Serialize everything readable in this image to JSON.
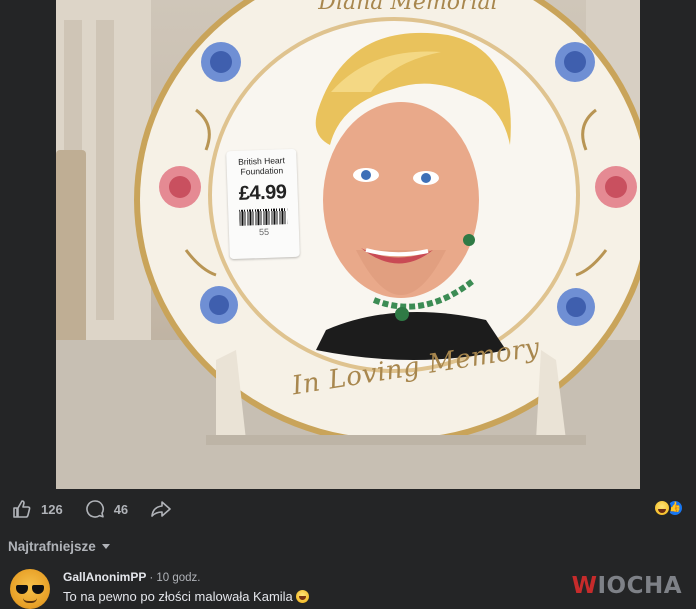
{
  "post": {
    "price_tag": {
      "shop": "British Heart Foundation",
      "price": "£4.99",
      "code": "55"
    },
    "plate_caption": "In Loving Memory",
    "plate_top_text": "Diana Memorial"
  },
  "actions": {
    "likes": "126",
    "comments": "46",
    "reactions": [
      "haha",
      "like"
    ]
  },
  "sort": {
    "label": "Najtrafniejsze"
  },
  "comment": {
    "author": "GallAnonimPP",
    "separator": "·",
    "time": "10 godz.",
    "text": "To na pewno po złości malowała Kamila"
  },
  "watermark": {
    "first": "W",
    "rest": "IOCHA"
  },
  "colors": {
    "background": "#242526",
    "text_secondary": "#b0b3b8",
    "like_blue": "#1877f2",
    "watermark_red": "#c62b2b"
  }
}
